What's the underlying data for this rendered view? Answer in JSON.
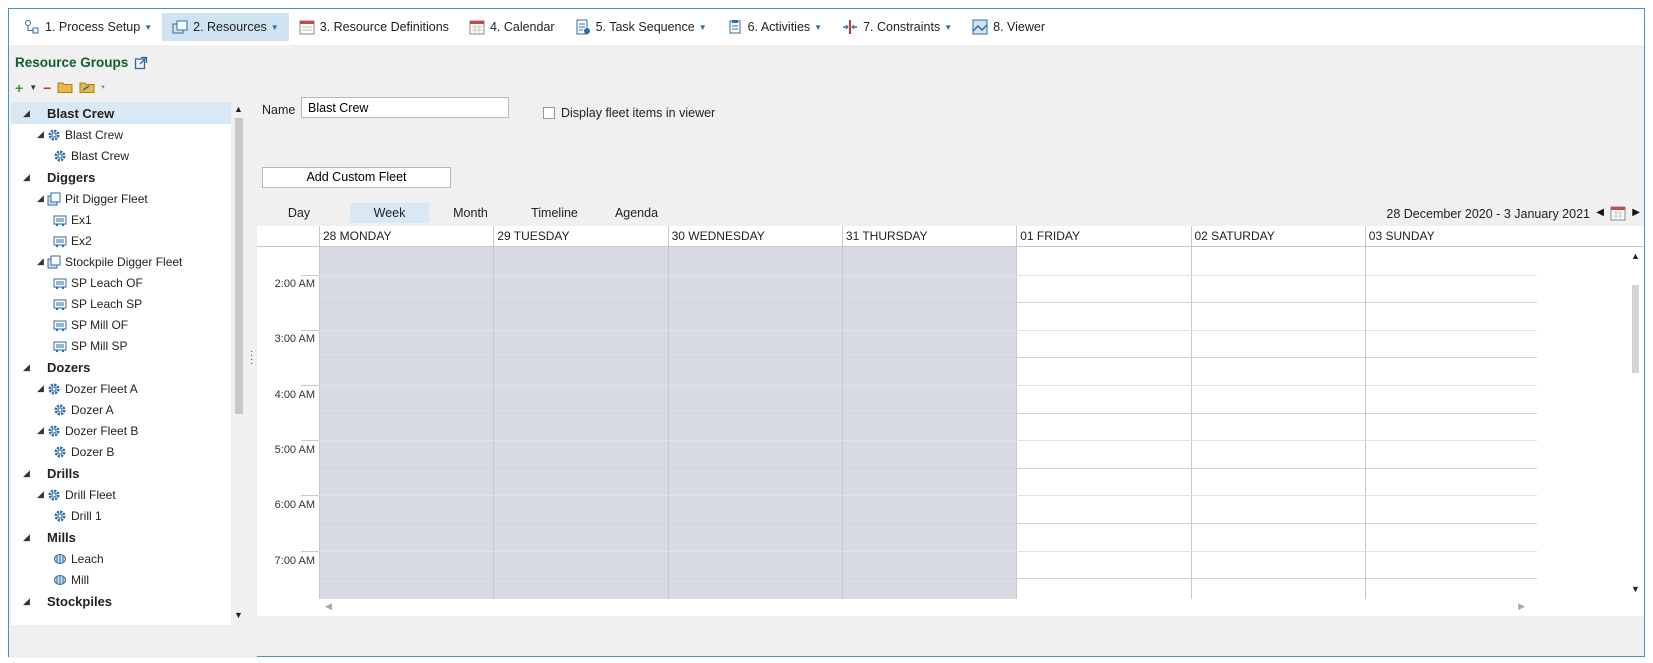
{
  "toolbar": {
    "items": [
      {
        "label": "1. Process Setup",
        "icon": "process-setup-icon",
        "dropdown": true,
        "active": false
      },
      {
        "label": "2. Resources",
        "icon": "resources-icon",
        "dropdown": true,
        "active": true
      },
      {
        "label": "3. Resource Definitions",
        "icon": "resource-definitions-icon",
        "dropdown": false,
        "active": false
      },
      {
        "label": "4. Calendar",
        "icon": "calendar-icon",
        "dropdown": false,
        "active": false
      },
      {
        "label": "5. Task Sequence",
        "icon": "task-sequence-icon",
        "dropdown": true,
        "active": false
      },
      {
        "label": "6. Activities",
        "icon": "activities-icon",
        "dropdown": true,
        "active": false
      },
      {
        "label": "7. Constraints",
        "icon": "constraints-icon",
        "dropdown": true,
        "active": false
      },
      {
        "label": "8. Viewer",
        "icon": "viewer-icon",
        "dropdown": false,
        "active": false
      }
    ]
  },
  "resource_groups": {
    "title": "Resource Groups",
    "tree": [
      {
        "label": "Blast Crew",
        "level": 0,
        "type": "group",
        "selected": true
      },
      {
        "label": "Blast Crew",
        "level": 1,
        "type": "gear",
        "expanded": true
      },
      {
        "label": "Blast Crew",
        "level": 2,
        "type": "gear"
      },
      {
        "label": "Diggers",
        "level": 0,
        "type": "group"
      },
      {
        "label": "Pit Digger Fleet",
        "level": 1,
        "type": "fleet",
        "expanded": true
      },
      {
        "label": "Ex1",
        "level": 2,
        "type": "truck"
      },
      {
        "label": "Ex2",
        "level": 2,
        "type": "truck"
      },
      {
        "label": "Stockpile Digger Fleet",
        "level": 1,
        "type": "fleet",
        "expanded": true
      },
      {
        "label": "SP Leach OF",
        "level": 2,
        "type": "truck"
      },
      {
        "label": "SP Leach SP",
        "level": 2,
        "type": "truck"
      },
      {
        "label": "SP Mill OF",
        "level": 2,
        "type": "truck"
      },
      {
        "label": "SP Mill SP",
        "level": 2,
        "type": "truck"
      },
      {
        "label": "Dozers",
        "level": 0,
        "type": "group"
      },
      {
        "label": "Dozer Fleet A",
        "level": 1,
        "type": "gear",
        "expanded": true
      },
      {
        "label": "Dozer A",
        "level": 2,
        "type": "gear"
      },
      {
        "label": "Dozer Fleet B",
        "level": 1,
        "type": "gear",
        "expanded": true
      },
      {
        "label": "Dozer B",
        "level": 2,
        "type": "gear"
      },
      {
        "label": "Drills",
        "level": 0,
        "type": "group"
      },
      {
        "label": "Drill Fleet",
        "level": 1,
        "type": "gear",
        "expanded": true
      },
      {
        "label": "Drill 1",
        "level": 2,
        "type": "gear"
      },
      {
        "label": "Mills",
        "level": 0,
        "type": "group"
      },
      {
        "label": "Leach",
        "level": 2,
        "type": "mill"
      },
      {
        "label": "Mill",
        "level": 2,
        "type": "mill"
      },
      {
        "label": "Stockpiles",
        "level": 0,
        "type": "group"
      }
    ]
  },
  "form": {
    "name_label": "Name",
    "name_value": "Blast Crew",
    "display_fleet_label": "Display fleet items in viewer",
    "display_fleet_checked": false,
    "add_custom_fleet_label": "Add Custom Fleet"
  },
  "scheduler": {
    "views": [
      {
        "label": "Day",
        "active": false
      },
      {
        "label": "Week",
        "active": true
      },
      {
        "label": "Month",
        "active": false
      },
      {
        "label": "Timeline",
        "active": false
      },
      {
        "label": "Agenda",
        "active": false
      }
    ],
    "date_range": "28 December 2020 - 3 January 2021",
    "days": [
      {
        "label": "28 MONDAY",
        "shaded": true
      },
      {
        "label": "29 TUESDAY",
        "shaded": true
      },
      {
        "label": "30 WEDNESDAY",
        "shaded": true
      },
      {
        "label": "31 THURSDAY",
        "shaded": true
      },
      {
        "label": "01 FRIDAY",
        "shaded": false
      },
      {
        "label": "02 SATURDAY",
        "shaded": false
      },
      {
        "label": "03 SUNDAY",
        "shaded": false
      }
    ],
    "times": [
      "2:00 AM",
      "3:00 AM",
      "4:00 AM",
      "5:00 AM",
      "6:00 AM",
      "7:00 AM"
    ],
    "colors": {
      "shade": "#d9dbe4",
      "accent": "#2d6ca8",
      "selected": "#d9e8f5"
    }
  }
}
